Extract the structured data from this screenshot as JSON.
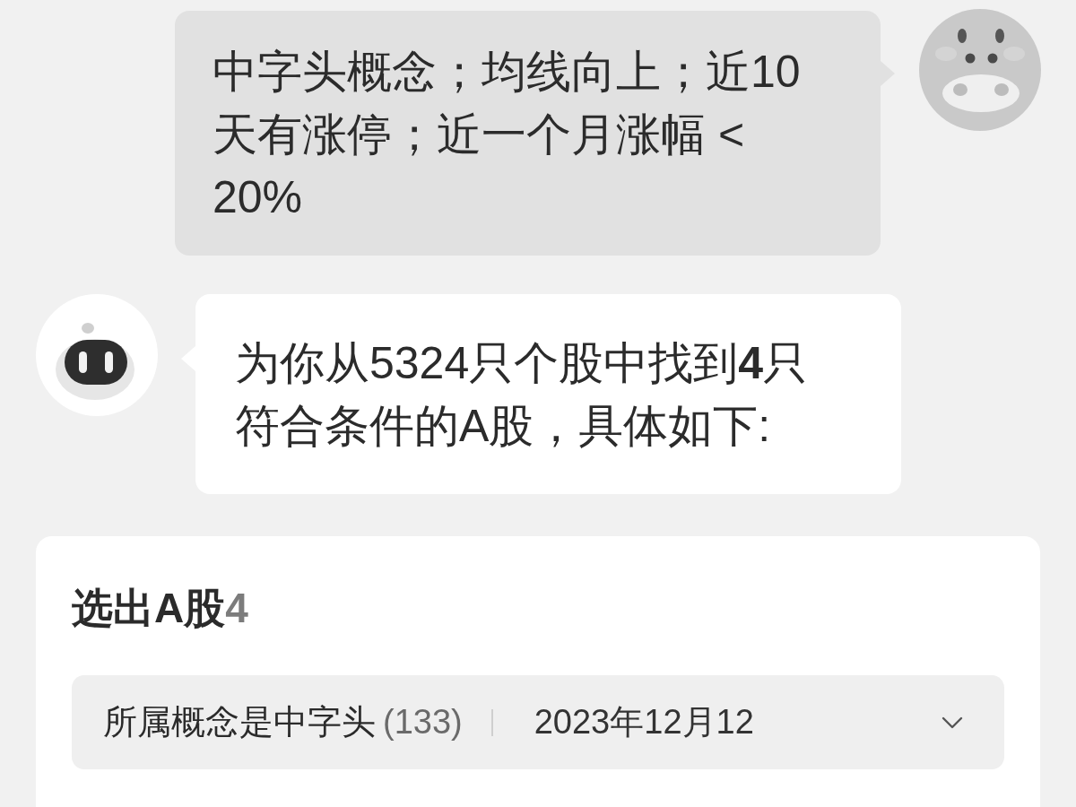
{
  "messages": [
    {
      "kind": "user",
      "text": "中字头概念；均线向上；近10天有涨停；近一个月涨幅 < 20%"
    },
    {
      "kind": "bot",
      "text": "为你从5324只个股中找到**4**只符合条件的A股，具体如下:"
    }
  ],
  "result_card": {
    "title": "选出A股",
    "count": "4",
    "filter": {
      "label": "所属概念是中字头",
      "count": "(133)",
      "date": "2023年12月12"
    }
  }
}
